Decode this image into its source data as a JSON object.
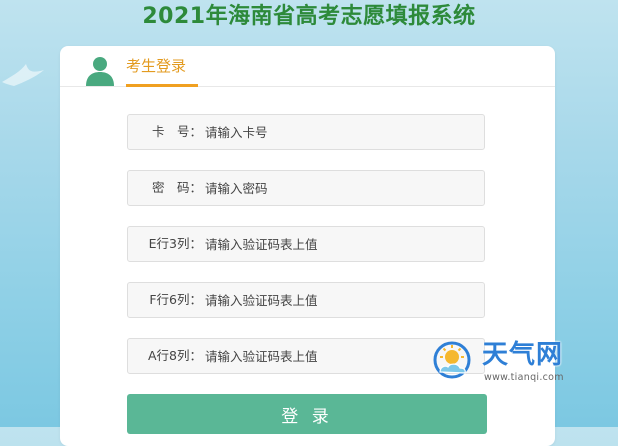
{
  "page": {
    "title": "2021年海南省高考志愿填报系统"
  },
  "login_tab": {
    "label": "考生登录"
  },
  "form": {
    "fields": [
      {
        "label": "卡　号：",
        "placeholder": "请输入卡号"
      },
      {
        "label": "密　码：",
        "placeholder": "请输入密码"
      },
      {
        "label": "E行3列：",
        "placeholder": "请输入验证码表上值"
      },
      {
        "label": "F行6列：",
        "placeholder": "请输入验证码表上值"
      },
      {
        "label": "A行8列：",
        "placeholder": "请输入验证码表上值"
      }
    ],
    "submit_label": "登 录"
  },
  "watermark": {
    "brand": "天气网",
    "url": "www.tianqi.com"
  },
  "colors": {
    "title": "#2d8a3a",
    "tab_accent": "#f0a020",
    "button": "#5ab796",
    "brand_blue": "#2e7fd6"
  }
}
